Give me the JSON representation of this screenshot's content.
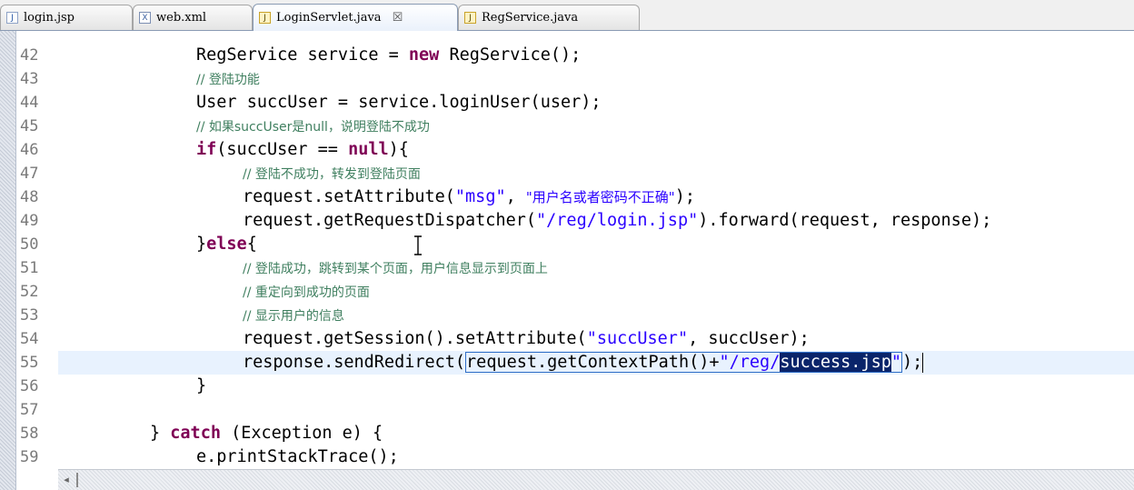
{
  "tabs": [
    {
      "label": "login.jsp",
      "icon": "jsp-file-icon",
      "active": false
    },
    {
      "label": "web.xml",
      "icon": "xml-file-icon",
      "active": false
    },
    {
      "label": "LoginServlet.java",
      "icon": "java-file-icon",
      "active": true,
      "close": "☒"
    },
    {
      "label": "RegService.java",
      "icon": "java-file-icon",
      "active": false
    }
  ],
  "editor": {
    "line_numbers": [
      "42",
      "43",
      "44",
      "45",
      "46",
      "47",
      "48",
      "49",
      "50",
      "51",
      "52",
      "53",
      "54",
      "55",
      "56",
      "57",
      "58",
      "59"
    ],
    "code": {
      "l42": {
        "a": "RegService service = ",
        "b": "new",
        "c": " RegService();"
      },
      "l43": {
        "cmt": "// 登陆功能"
      },
      "l44": {
        "a": "User succUser = service.loginUser(user);"
      },
      "l45": {
        "cmt": "// 如果succUser是null，说明登陆不成功"
      },
      "l46": {
        "kw1": "if",
        "a": "(succUser == ",
        "kw2": "null",
        "b": "){"
      },
      "l47": {
        "cmt": "// 登陆不成功，转发到登陆页面"
      },
      "l48": {
        "a": "request.setAttribute(",
        "s1": "\"msg\"",
        "b": ", ",
        "s2": "\"用户名或者密码不正确\"",
        "c": ");"
      },
      "l49": {
        "a": "request.getRequestDispatcher(",
        "s1": "\"/reg/login.jsp\"",
        "b": ").forward(request, response);"
      },
      "l50": {
        "a": "}",
        "kw": "else",
        "b": "{"
      },
      "l51": {
        "cmt": "// 登陆成功，跳转到某个页面，用户信息显示到页面上"
      },
      "l52": {
        "cmt": "// 重定向到成功的页面"
      },
      "l53": {
        "cmt": "// 显示用户的信息"
      },
      "l54": {
        "a": "request.getSession().setAttribute(",
        "s1": "\"succUser\"",
        "b": ", succUser);"
      },
      "l55": {
        "a": "response.sendRedirect(",
        "b": "request.getContextPath()+",
        "s1": "\"/reg/",
        "sel": "success.jsp",
        "s2": "\"",
        "c": ");"
      },
      "l56": {
        "a": "}"
      },
      "l58": {
        "a": "} ",
        "kw": "catch",
        "b": " (Exception e) {"
      },
      "l59": {
        "a": "e.printStackTrace();"
      }
    }
  },
  "colors": {
    "keyword": "#7f0055",
    "string": "#2a00ff",
    "comment": "#3f7f5f",
    "selection": "#0a246a"
  }
}
